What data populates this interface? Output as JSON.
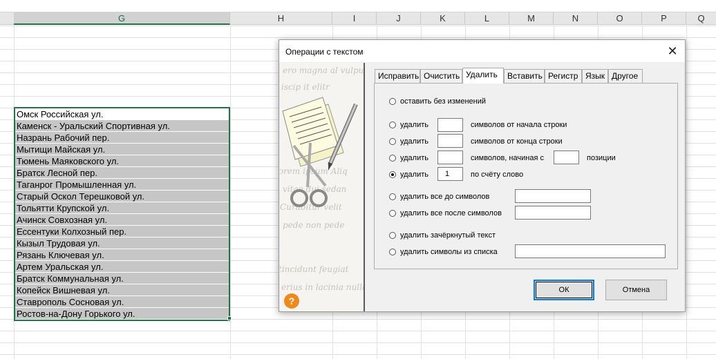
{
  "columns": [
    "G",
    "H",
    "I",
    "J",
    "K",
    "L",
    "M",
    "N",
    "O",
    "P",
    "Q"
  ],
  "cells": [
    "Омск Российская ул.",
    "Каменск - Уральский Спортивная ул.",
    "Назрань Рабочий пер.",
    "Мытищи Майская ул.",
    "Тюмень Маяковского ул.",
    "Братск Лесной пер.",
    "Таганрог Промышленная ул.",
    "Старый Оскол Терешковой ул.",
    "Тольятти Крупской ул.",
    "Ачинск Совхозная ул.",
    "Ессентуки Колхозный пер.",
    "Кызыл Трудовая ул.",
    "Рязань Ключевая ул.",
    "Артем Уральская ул.",
    "Братск Коммунальная ул.",
    "Копейск Вишневая ул.",
    "Ставрополь Сосновая ул.",
    "Ростов-на-Дону Горького ул."
  ],
  "dialog": {
    "title": "Операции с текстом",
    "close_icon": "close-icon",
    "help_label": "?",
    "tabs": [
      "Исправить",
      "Очистить",
      "Удалить",
      "Вставить",
      "Регистр",
      "Язык",
      "Другое"
    ],
    "active_tab": "Удалить",
    "options": {
      "keep": "оставить без изменений",
      "delete_label": "удалить",
      "from_start": "символов от начала строки",
      "from_end": "символов от конца строки",
      "starting_at": "символов, начиная с",
      "position": "позиции",
      "word_by_count": "по счёту слово",
      "word_count_value": "1",
      "all_before": "удалить все до символов",
      "all_after": "удалить все после символов",
      "strikethrough": "удалить зачёркнутый текст",
      "from_list": "удалить символы из списка"
    },
    "ok_label": "ОК",
    "cancel_label": "Отмена"
  }
}
